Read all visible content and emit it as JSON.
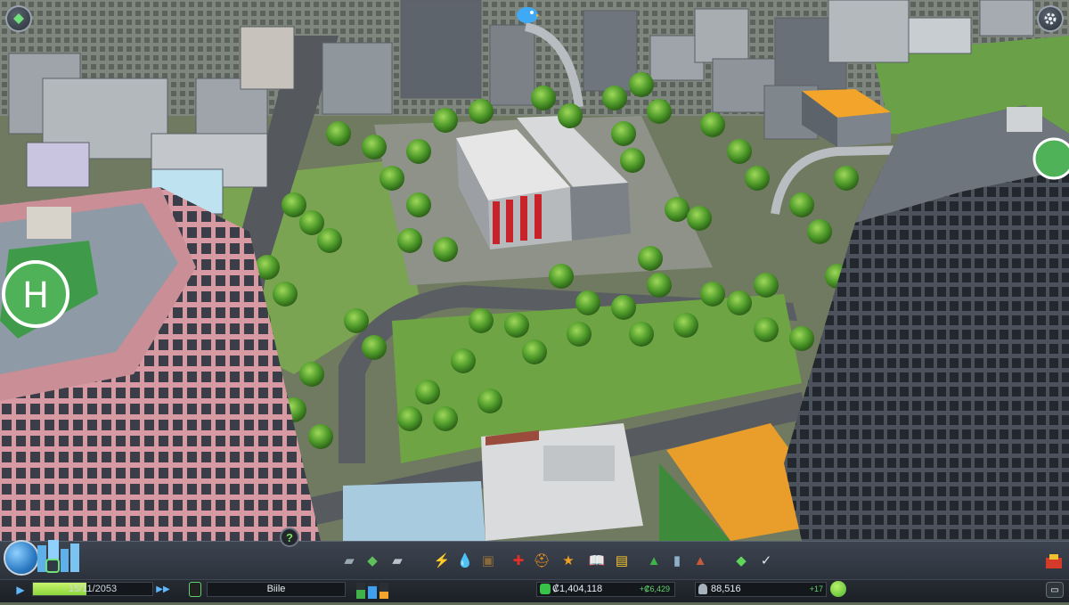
{
  "status": {
    "date": "15/11/2053",
    "time_progress": 0.45,
    "city_name": "Biile",
    "money": "₡1,404,118",
    "money_delta": "+₡6,429",
    "population": "88,516",
    "population_delta": "+17"
  },
  "icons": {
    "top_left": "zone-info-icon",
    "top_right": "gear-icon",
    "chirper": "chirper-bird-icon",
    "advisor": "?",
    "play": "▶",
    "speed": "▶▶",
    "chirper_small": "▭"
  },
  "toolbar": {
    "tools": [
      {
        "name": "roads-tool-icon",
        "glyph": "▰",
        "color": "#9aa6b2"
      },
      {
        "name": "zoning-tool-icon",
        "glyph": "◆",
        "color": "#5fbf5a"
      },
      {
        "name": "districts-tool-icon",
        "glyph": "▰",
        "color": "#b9c3cc"
      },
      {
        "name": "electricity-tool-icon",
        "glyph": "⚡",
        "color": "#4aa3ff"
      },
      {
        "name": "water-tool-icon",
        "glyph": "💧",
        "color": "#4aa3ff"
      },
      {
        "name": "garbage-tool-icon",
        "glyph": "▣",
        "color": "#8a6a3c"
      },
      {
        "name": "healthcare-tool-icon",
        "glyph": "✚",
        "color": "#e0302a"
      },
      {
        "name": "fire-tool-icon",
        "glyph": "⛑",
        "color": "#f09020"
      },
      {
        "name": "police-tool-icon",
        "glyph": "★",
        "color": "#f0a020"
      },
      {
        "name": "education-tool-icon",
        "glyph": "📖",
        "color": "#e9e0c8"
      },
      {
        "name": "public-transport-tool-icon",
        "glyph": "▤",
        "color": "#f2c230"
      },
      {
        "name": "parks-tool-icon",
        "glyph": "▲",
        "color": "#3fb34a"
      },
      {
        "name": "unique-buildings-tool-icon",
        "glyph": "▮",
        "color": "#8fb0c8"
      },
      {
        "name": "monuments-tool-icon",
        "glyph": "▲",
        "color": "#c65a3a"
      },
      {
        "name": "economy-tool-icon",
        "glyph": "◆",
        "color": "#5fd35a"
      },
      {
        "name": "policies-tool-icon",
        "glyph": "✓",
        "color": "#dfe5ea"
      }
    ]
  },
  "colors": {
    "money_green": "#62d26b",
    "time_fill": "#a6e24c"
  }
}
